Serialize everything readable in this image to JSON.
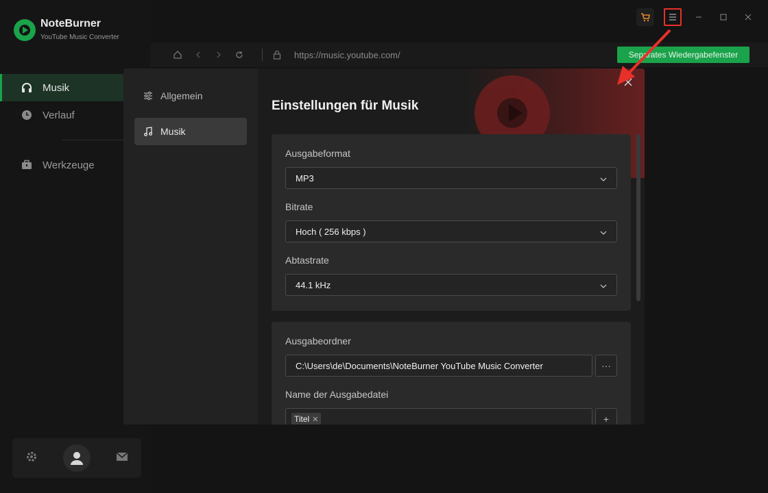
{
  "app": {
    "brand_name": "NoteBurner",
    "brand_sub": "YouTube Music Converter"
  },
  "sidebar": {
    "items": [
      {
        "label": "Musik",
        "icon": "headphones-icon",
        "active": true
      },
      {
        "label": "Verlauf",
        "icon": "clock-icon",
        "active": false
      },
      {
        "label": "Werkzeuge",
        "icon": "toolbox-icon",
        "active": false
      }
    ]
  },
  "addressbar": {
    "url": "https://music.youtube.com/",
    "separate_window_label": "Separates Wiedergabefenster"
  },
  "settings": {
    "nav": [
      {
        "label": "Allgemein",
        "icon": "sliders-icon",
        "active": false
      },
      {
        "label": "Musik",
        "icon": "music-note-icon",
        "active": true
      }
    ],
    "title": "Einstellungen für Musik",
    "output_format": {
      "label": "Ausgabeformat",
      "value": "MP3"
    },
    "bitrate": {
      "label": "Bitrate",
      "value": "Hoch ( 256 kbps )"
    },
    "sample_rate": {
      "label": "Abtastrate",
      "value": "44.1 kHz"
    },
    "output_folder": {
      "label": "Ausgabeordner",
      "value": "C:\\Users\\de\\Documents\\NoteBurner YouTube Music Converter",
      "browse_label": "···"
    },
    "output_filename": {
      "label": "Name der Ausgabedatei",
      "tags": [
        "Titel"
      ],
      "add_label": "+"
    }
  },
  "colors": {
    "accent": "#1aa34a",
    "highlight_box": "#e8302a"
  }
}
